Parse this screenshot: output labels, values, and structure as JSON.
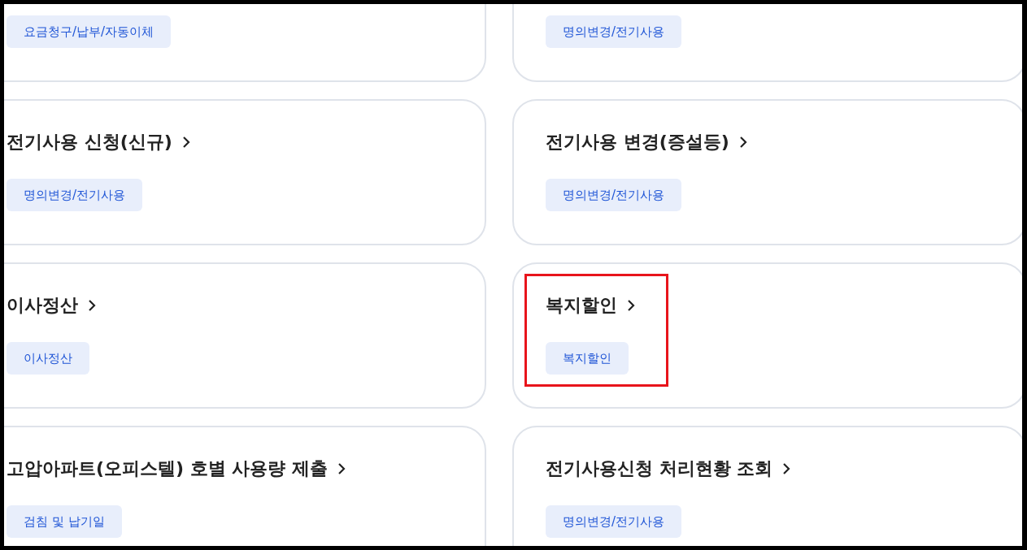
{
  "cards": [
    {
      "tag": "요금청구/납부/자동이체",
      "highlighted": false
    },
    {
      "tag": "명의변경/전기사용",
      "highlighted": false
    },
    {
      "title": "전기사용 신청(신규)",
      "tag": "명의변경/전기사용",
      "highlighted": false
    },
    {
      "title": "전기사용 변경(증설등)",
      "tag": "명의변경/전기사용",
      "highlighted": false
    },
    {
      "title": "이사정산",
      "tag": "이사정산",
      "highlighted": false
    },
    {
      "title": "복지할인",
      "tag": "복지할인",
      "highlighted": true
    },
    {
      "title": "고압아파트(오피스텔) 호별 사용량 제출",
      "tag": "검침 및 납기일",
      "highlighted": false
    },
    {
      "title": "전기사용신청 처리현황 조회",
      "tag": "명의변경/전기사용",
      "highlighted": false
    }
  ]
}
